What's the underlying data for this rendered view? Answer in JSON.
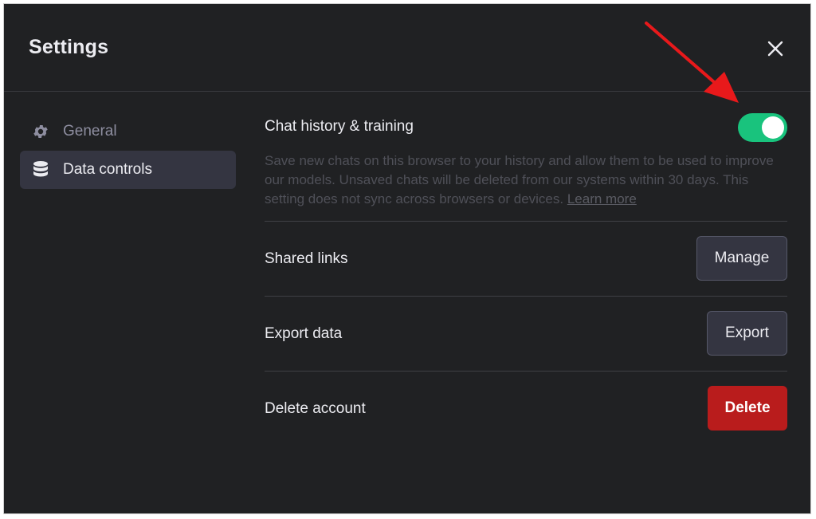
{
  "header": {
    "title": "Settings",
    "close_icon": "close-icon"
  },
  "sidebar": {
    "items": [
      {
        "label": "General",
        "icon": "gear-icon",
        "active": false
      },
      {
        "label": "Data controls",
        "icon": "database-icon",
        "active": true
      }
    ]
  },
  "chat_history": {
    "label": "Chat history & training",
    "enabled": true,
    "description": "Save new chats on this browser to your history and allow them to be used to improve our models. Unsaved chats will be deleted from our systems within 30 days. This setting does not sync across browsers or devices. ",
    "learn_more": "Learn more"
  },
  "shared_links": {
    "label": "Shared links",
    "button": "Manage"
  },
  "export_data": {
    "label": "Export data",
    "button": "Export"
  },
  "delete_account": {
    "label": "Delete account",
    "button": "Delete"
  },
  "colors": {
    "toggle_on": "#19c37d",
    "danger": "#b91c1c",
    "annotation_arrow": "#e8191b",
    "panel_bg": "#202123"
  }
}
